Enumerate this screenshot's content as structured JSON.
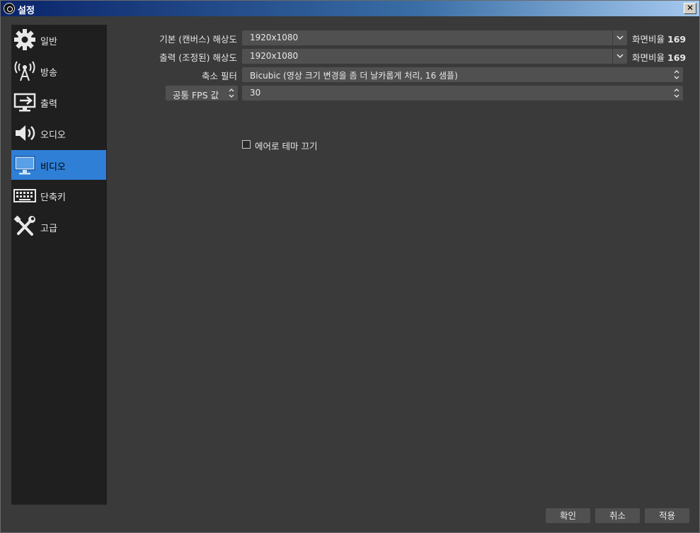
{
  "window": {
    "title": "설정",
    "close_glyph": "✕"
  },
  "sidebar": {
    "items": [
      {
        "label": "일반",
        "icon": "gear-icon"
      },
      {
        "label": "방송",
        "icon": "antenna-icon"
      },
      {
        "label": "출력",
        "icon": "output-monitor-icon"
      },
      {
        "label": "오디오",
        "icon": "speaker-icon"
      },
      {
        "label": "비디오",
        "icon": "monitor-icon",
        "active": true
      },
      {
        "label": "단축키",
        "icon": "keyboard-icon"
      },
      {
        "label": "고급",
        "icon": "tools-icon"
      }
    ]
  },
  "video": {
    "base_resolution": {
      "label": "기본 (캔버스) 해상도",
      "value": "1920x1080",
      "aspect_label": "화면비율",
      "aspect_value": "169"
    },
    "output_resolution": {
      "label": "출력 (조정된) 해상도",
      "value": "1920x1080",
      "aspect_label": "화면비율",
      "aspect_value": "169"
    },
    "downscale_filter": {
      "label": "축소 필터",
      "value": "Bicubic (영상 크기 변경을 좀 더 날카롭게 처리, 16 샘플)"
    },
    "fps": {
      "type_label": "공통 FPS 값",
      "value": "30"
    },
    "aero": {
      "label": "에어로 테마 끄기",
      "checked": false
    }
  },
  "buttons": {
    "ok": "확인",
    "cancel": "취소",
    "apply": "적용"
  },
  "colors": {
    "accent": "#2f7fd6",
    "panel": "#3a3a3a",
    "sidebar": "#1f1f1f",
    "field": "#505050"
  }
}
